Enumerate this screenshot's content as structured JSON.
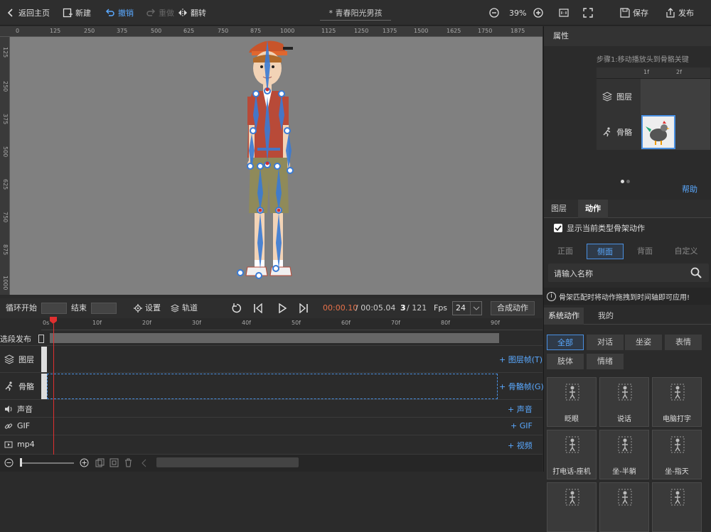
{
  "topbar": {
    "back": "返回主页",
    "new": "新建",
    "undo": "撤销",
    "redo": "重做",
    "flip": "翻转",
    "doc_title": "* 青春阳光男孩",
    "zoom": "39%",
    "save": "保存",
    "publish": "发布"
  },
  "ruler_top": [
    "0",
    "125",
    "250",
    "375",
    "500",
    "625",
    "750",
    "875",
    "1000",
    "1125",
    "1250",
    "1375",
    "1500",
    "1625",
    "1750",
    "1875"
  ],
  "ruler_left": [
    "125",
    "250",
    "375",
    "500",
    "625",
    "750",
    "875",
    "1000"
  ],
  "right_panel": {
    "title": "属性",
    "step": "步骤1:移动播放头到骨骼关键",
    "frame_cols": [
      "1f",
      "2f"
    ],
    "row_layer": "图层",
    "row_bone": "骨骼",
    "help": "帮助",
    "tabs": [
      "图层",
      "动作"
    ],
    "show_checkbox": "显示当前类型骨架动作",
    "views": [
      "正面",
      "侧面",
      "背面",
      "自定义"
    ],
    "search_placeholder": "请输入名称",
    "notice": "骨架匹配时将动作拖拽到时间轴即可应用!",
    "lib_tabs": [
      "系统动作",
      "我的"
    ],
    "categories": [
      "全部",
      "对话",
      "坐姿",
      "表情",
      "肢体",
      "情绪"
    ],
    "actions": [
      "眨眼",
      "说话",
      "电脑打字",
      "打电话-座机",
      "坐-半躺",
      "坐-指天",
      "",
      "",
      ""
    ]
  },
  "timeline": {
    "loop_start": "循环开始",
    "end": "结束",
    "settings": "设置",
    "track": "轨道",
    "time_current": "00:00.10",
    "time_total": "/ 00:05.04",
    "frame_current": "3",
    "frame_total": "/ 121",
    "fps_label": "Fps",
    "fps_value": "24",
    "compose": "合成动作",
    "ticks": [
      "0s",
      "10f",
      "20f",
      "30f",
      "40f",
      "50f",
      "60f",
      "70f",
      "80f",
      "90f"
    ],
    "rows": {
      "publish": "选段发布",
      "layer": "图层",
      "layer_add": "+ 图层帧(T)",
      "bone": "骨骼",
      "bone_add": "+ 骨骼帧(G)",
      "sound": "声音",
      "sound_add": "+ 声音",
      "gif": "GIF",
      "gif_add": "+ GIF",
      "mp4": "mp4",
      "mp4_add": "+ 视频"
    }
  },
  "colors": {
    "accent": "#4a90e2",
    "playhead": "#e03030"
  }
}
